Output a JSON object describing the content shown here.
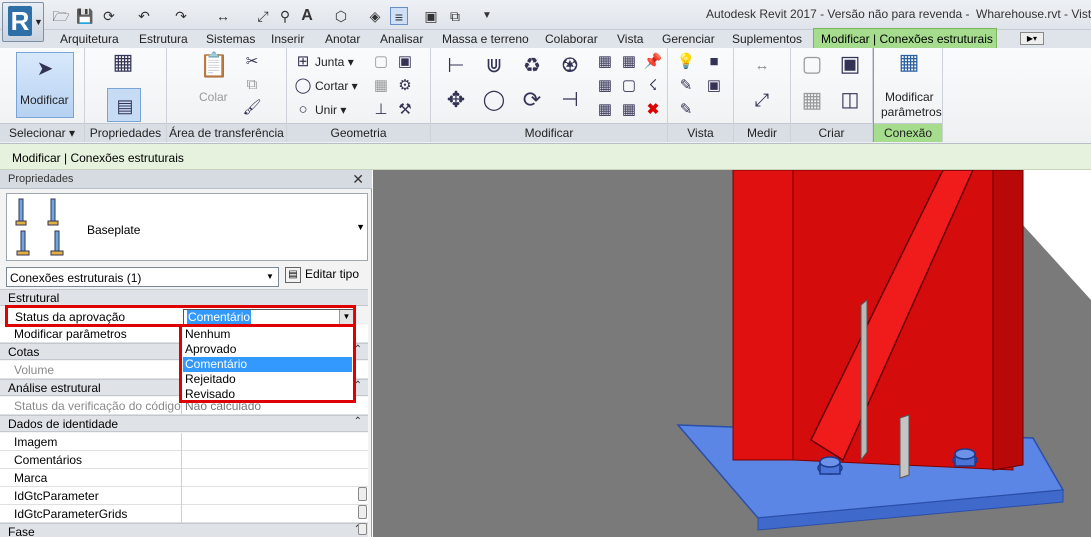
{
  "titlebar": {
    "app_title": "Autodesk Revit 2017 - Versão não para revenda -",
    "file_title": "Wharehouse.rvt - Vista"
  },
  "tabs": [
    "Arquitetura",
    "Estrutura",
    "Sistemas",
    "Inserir",
    "Anotar",
    "Analisar",
    "Massa e terreno",
    "Colaborar",
    "Vista",
    "Gerenciar",
    "Suplementos"
  ],
  "active_tab": "Modificar | Conexões estruturais",
  "ribbon": {
    "modify_button": "Modificar",
    "select_panel": "Selecionar",
    "properties_panel": "Propriedades",
    "clipboard_panel": "Área de transferência",
    "paste_label": "Colar",
    "join_label": "Junta",
    "cut_label": "Cortar",
    "unite_label": "Unir",
    "geometry_panel": "Geometria",
    "modify_panel": "Modificar",
    "view_panel": "Vista",
    "measure_panel": "Medir",
    "create_panel": "Criar",
    "modify_params_line1": "Modificar",
    "modify_params_line2": "parâmetros",
    "connection_panel": "Conexão"
  },
  "context_bar": "Modificar | Conexões estruturais",
  "properties": {
    "header": "Propriedades",
    "type_name": "Baseplate",
    "instance_selector": "Conexões estruturais (1)",
    "edit_type": "Editar tipo",
    "groups": {
      "structural": "Estrutural",
      "dimensions": "Cotas",
      "analysis": "Análise estrutural",
      "identity": "Dados de identidade",
      "phase": "Fase"
    },
    "status_label": "Status da aprovação",
    "status_value": "Comentário",
    "modify_params": "Modificar parâmetros",
    "volume": "Volume",
    "check_status": "Status da verificação do código",
    "check_status_value": "Não calculado",
    "identity_rows": [
      "Imagem",
      "Comentários",
      "Marca",
      "IdGtcParameter",
      "IdGtcParameterGrids"
    ],
    "dropdown_options": [
      "Nenhum",
      "Aprovado",
      "Comentário",
      "Rejeitado",
      "Revisado"
    ],
    "dropdown_selected_index": 2
  },
  "colors": {
    "active_tab": "#a5dc8d",
    "highlight": "#e00000",
    "selection": "#3399ff",
    "steel_red": "#e01010",
    "plate_blue": "#5b86e6"
  }
}
